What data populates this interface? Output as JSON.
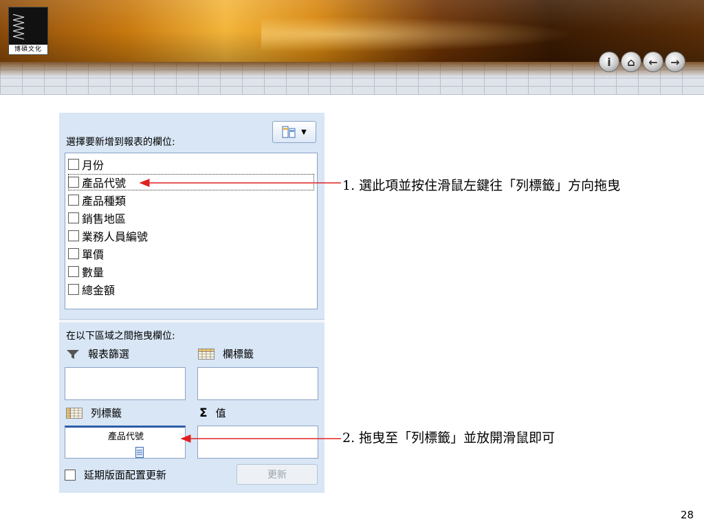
{
  "logo": {
    "text": "博碩文化"
  },
  "nav": {
    "icons": [
      "info-icon",
      "home-icon",
      "back-arrow-icon",
      "forward-arrow-icon"
    ],
    "glyphs": [
      "i",
      "⌂",
      "←",
      "→"
    ]
  },
  "panel": {
    "fields_label": "選擇要新增到報表的欄位:",
    "fields": [
      "月份",
      "產品代號",
      "產品種類",
      "銷售地區",
      "業務人員編號",
      "單價",
      "數量",
      "總金額"
    ],
    "selected_field_index": 1,
    "areas_label": "在以下區域之間拖曳欄位:",
    "report_filter_label": "報表篩選",
    "column_labels_label": "欄標籤",
    "row_labels_label": "列標籤",
    "values_symbol": "Σ",
    "values_label": "值",
    "dragging_item_text": "產品代號",
    "defer_label": "延期版面配置更新",
    "update_label": "更新"
  },
  "annotations": {
    "step1": "1. 選此項並按住滑鼠左鍵往「列標籤」方向拖曳",
    "step2": "2. 拖曳至「列標籤」並放開滑鼠即可",
    "arrow_color": "#e02020"
  },
  "page_number": "28"
}
